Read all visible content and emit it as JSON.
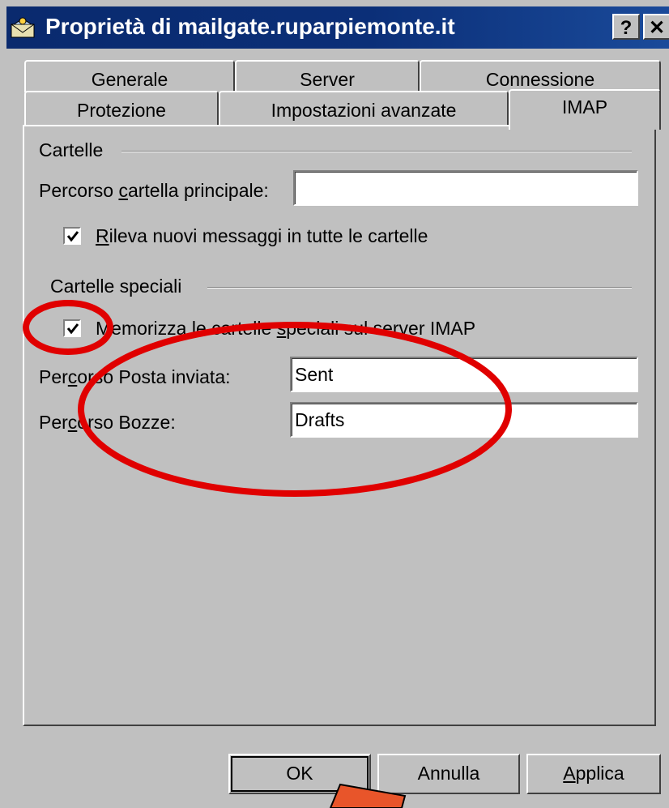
{
  "window": {
    "title": "Proprietà di mailgate.ruparpiemonte.it",
    "help_button": "?",
    "close_button": "✕"
  },
  "tabs": {
    "row1": [
      "Generale",
      "Server",
      "Connessione"
    ],
    "row2": [
      "Protezione",
      "Impostazioni avanzate",
      "IMAP"
    ],
    "active": "IMAP"
  },
  "cartelle": {
    "group_label": "Cartelle",
    "root_path_label_pre": "Percorso ",
    "root_path_label_key": "c",
    "root_path_label_post": "artella principale:",
    "root_path_value": "",
    "check_new_key": "R",
    "check_new_label": "ileva nuovi messaggi in tutte le cartelle",
    "check_new_checked": true
  },
  "speciali": {
    "group_label": "Cartelle speciali",
    "store_label_pre": "Memorizza le cartelle ",
    "store_label_key": "s",
    "store_label_post": "peciali sul server IMAP",
    "store_checked": true,
    "sent_label_pre": "Per",
    "sent_label_key": "c",
    "sent_label_post": "orso Posta inviata:",
    "sent_value": "Sent",
    "drafts_label_pre": "Per",
    "drafts_label_key": "c",
    "drafts_label_post": "orso Bozze:",
    "drafts_value": "Drafts"
  },
  "buttons": {
    "ok": "OK",
    "cancel": "Annulla",
    "apply_key": "A",
    "apply_post": "pplica"
  },
  "annotation_colors": {
    "ellipse": "#e00000",
    "arrow": "#e8552a"
  }
}
